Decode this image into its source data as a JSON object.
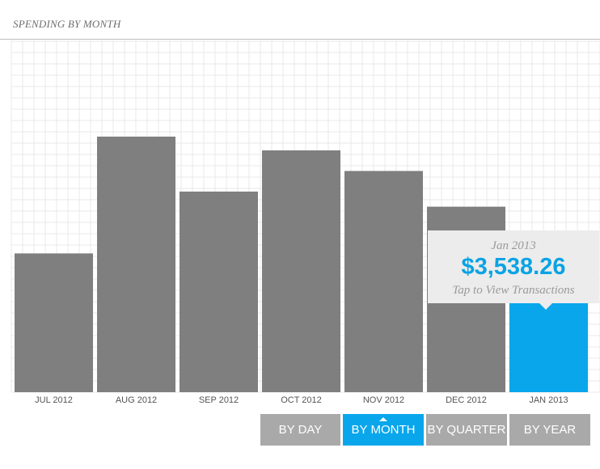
{
  "header": {
    "title": "SPENDING BY MONTH"
  },
  "chart_data": {
    "type": "bar",
    "categories": [
      "JUL 2012",
      "AUG 2012",
      "SEP 2012",
      "OCT 2012",
      "NOV 2012",
      "DEC 2012",
      "JAN 2013"
    ],
    "values": [
      5050,
      9300,
      7300,
      8800,
      8050,
      6750,
      3538.26
    ],
    "highlighted_index": 6,
    "ylim": [
      0,
      12800
    ],
    "grid": true,
    "colors": {
      "bar": "#7f7f7f",
      "highlight": "#09a6ec",
      "grid": "#e9e9e9",
      "axis_label": "#555555"
    }
  },
  "tooltip": {
    "period": "Jan 2013",
    "amount": "$3,538.26",
    "hint": "Tap to View Transactions"
  },
  "controls": {
    "by_day": "BY DAY",
    "by_month": "BY MONTH",
    "by_quarter": "BY QUARTER",
    "by_year": "BY YEAR",
    "active": "by_month"
  }
}
